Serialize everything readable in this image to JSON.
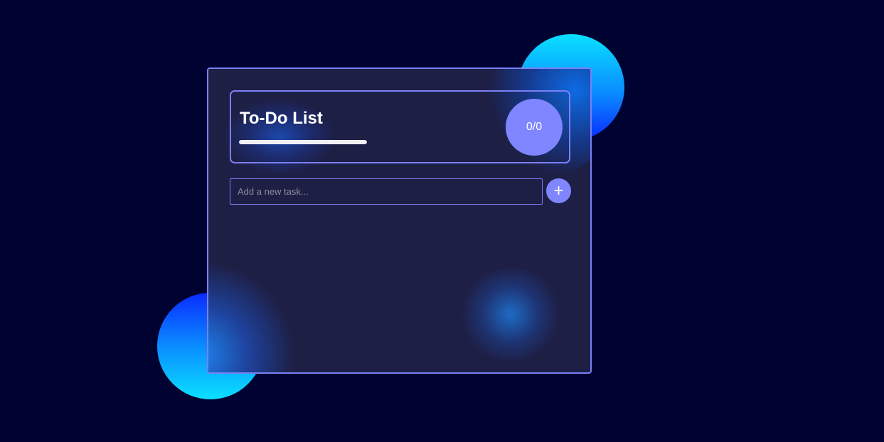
{
  "app": {
    "title": "To-Do List",
    "counter": "0/0",
    "progress_fraction": 0.0
  },
  "input": {
    "placeholder": "Add a new task...",
    "value": ""
  },
  "add_button": {
    "label": "+"
  },
  "tasks": [],
  "colors": {
    "background": "#000232",
    "card": "#1e1f45",
    "accent": "#7f86ff",
    "border": "#7b80f5",
    "orb_cyan": "#0ae0ff",
    "orb_blue": "#0a2bff"
  }
}
